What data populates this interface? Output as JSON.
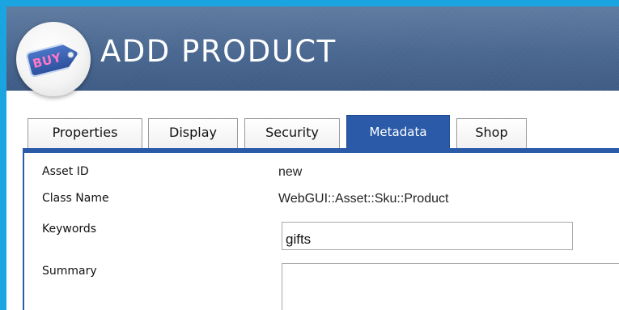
{
  "header": {
    "title": "ADD PRODUCT",
    "logo_text": "BUY"
  },
  "tabs": [
    {
      "label": "Properties",
      "active": false
    },
    {
      "label": "Display",
      "active": false
    },
    {
      "label": "Security",
      "active": false
    },
    {
      "label": "Metadata",
      "active": true
    },
    {
      "label": "Shop",
      "active": false
    }
  ],
  "form": {
    "asset_id_label": "Asset ID",
    "asset_id_value": "new",
    "class_name_label": "Class Name",
    "class_name_value": "WebGUI::Asset::Sku::Product",
    "keywords_label": "Keywords",
    "keywords_value": "gifts",
    "summary_label": "Summary",
    "summary_value": ""
  },
  "colors": {
    "background": "#1aa5e0",
    "header": "#48668f",
    "active_tab": "#2a5aa8"
  }
}
